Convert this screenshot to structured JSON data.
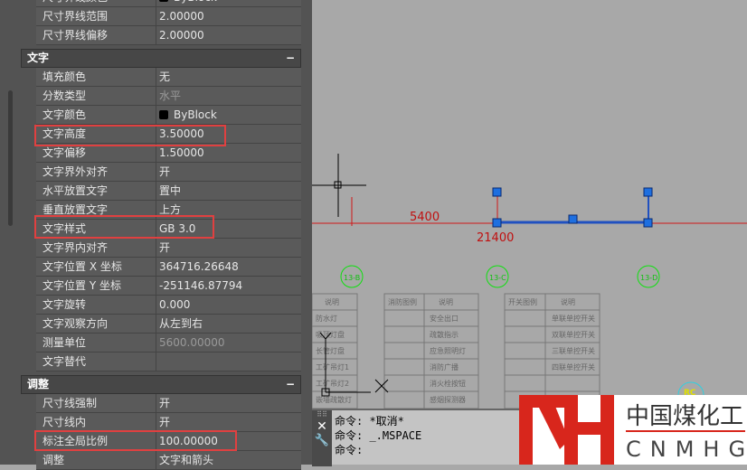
{
  "properties": {
    "top_rows": [
      {
        "label": "尺寸界线颜色",
        "value": "ByBlock",
        "swatch": true
      },
      {
        "label": "尺寸界线范围",
        "value": "2.00000"
      },
      {
        "label": "尺寸界线偏移",
        "value": "2.00000"
      }
    ],
    "sections": [
      {
        "title": "文字",
        "toggle": "−",
        "rows": [
          {
            "label": "填充颜色",
            "value": "无"
          },
          {
            "label": "分数类型",
            "value": "水平",
            "dim": true
          },
          {
            "label": "文字颜色",
            "value": "ByBlock",
            "swatch": true
          },
          {
            "label": "文字高度",
            "value": "3.50000"
          },
          {
            "label": "文字偏移",
            "value": "1.50000"
          },
          {
            "label": "文字界外对齐",
            "value": "开"
          },
          {
            "label": "水平放置文字",
            "value": "置中"
          },
          {
            "label": "垂直放置文字",
            "value": "上方"
          },
          {
            "label": "文字样式",
            "value": "GB 3.0"
          },
          {
            "label": "文字界内对齐",
            "value": "开"
          },
          {
            "label": "文字位置 X 坐标",
            "value": "364716.26648"
          },
          {
            "label": "文字位置 Y 坐标",
            "value": "-251146.87794"
          },
          {
            "label": "文字旋转",
            "value": "0.000"
          },
          {
            "label": "文字观察方向",
            "value": "从左到右"
          },
          {
            "label": "测量单位",
            "value": "5600.00000",
            "dim": true
          },
          {
            "label": "文字替代",
            "value": ""
          }
        ]
      },
      {
        "title": "调整",
        "toggle": "−",
        "rows": [
          {
            "label": "尺寸线强制",
            "value": "开"
          },
          {
            "label": "尺寸线内",
            "value": "开"
          },
          {
            "label": "标注全局比例",
            "value": "100.00000"
          },
          {
            "label": "调整",
            "value": "文字和箭头"
          }
        ]
      }
    ]
  },
  "drawing": {
    "dim1": "5400",
    "dim2": "21400",
    "tags": [
      "13-B",
      "13-C",
      "13-D"
    ],
    "rc": "RC",
    "table1_header": "说明",
    "table2_headers": [
      "消防图例",
      "说明"
    ],
    "table2_rows": [
      "安全出口",
      "疏散指示",
      "应急照明灯",
      "消防广播",
      "消火栓按钮",
      "感烟探测器"
    ],
    "table3_headers": [
      "开关图例",
      "说明"
    ],
    "table3_rows": [
      "单联单控开关",
      "双联单控开关",
      "三联单控开关",
      "四联单控开关"
    ],
    "table1_rows": [
      "防水灯",
      "吸顶灯盘",
      "长管灯盘",
      "工矿吊灯1",
      "工矿吊灯2",
      "嵌墙疏散灯"
    ]
  },
  "command": {
    "lines": [
      "命令: *取消*",
      "命令: _.MSPACE",
      "命令:"
    ]
  },
  "logo": {
    "cn": "中国煤化工",
    "en": "CNMHG",
    "mark": "MH"
  },
  "colors": {
    "accent": "#e04040",
    "grip": "#1e6fe0",
    "dimline": "#d01818"
  }
}
